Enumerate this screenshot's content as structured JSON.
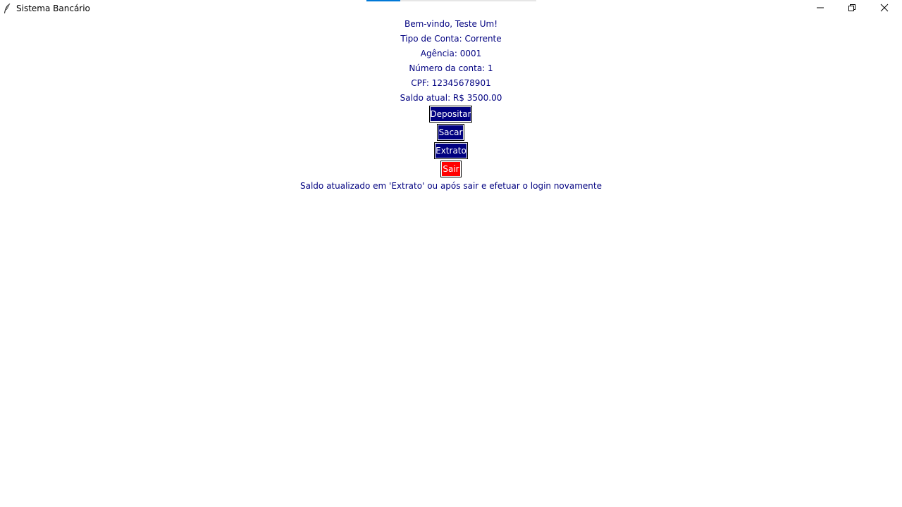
{
  "window": {
    "title": "Sistema Bancário",
    "app_icon": "feather-icon",
    "controls": {
      "minimize_icon": "minimize-icon",
      "maximize_icon": "restore-icon",
      "close_icon": "close-icon"
    },
    "progress": 0.2
  },
  "account": {
    "welcome": "Bem-vindo, Teste Um!",
    "account_type": "Tipo de Conta: Corrente",
    "agency": "Agência: 0001",
    "account_number": "Número da conta: 1",
    "cpf": "CPF: 12345678901",
    "balance": "Saldo atual: R$ 3500.00"
  },
  "actions": {
    "deposit_label": "Depositar",
    "withdraw_label": "Sacar",
    "statement_label": "Extrato",
    "exit_label": "Sair"
  },
  "footer": {
    "note": "Saldo atualizado em 'Extrato' ou após sair e efetuar o login novamente"
  },
  "colors": {
    "text": "#000080",
    "button_primary": "#000080",
    "button_exit": "#ff0000",
    "button_text": "#ffffff"
  }
}
